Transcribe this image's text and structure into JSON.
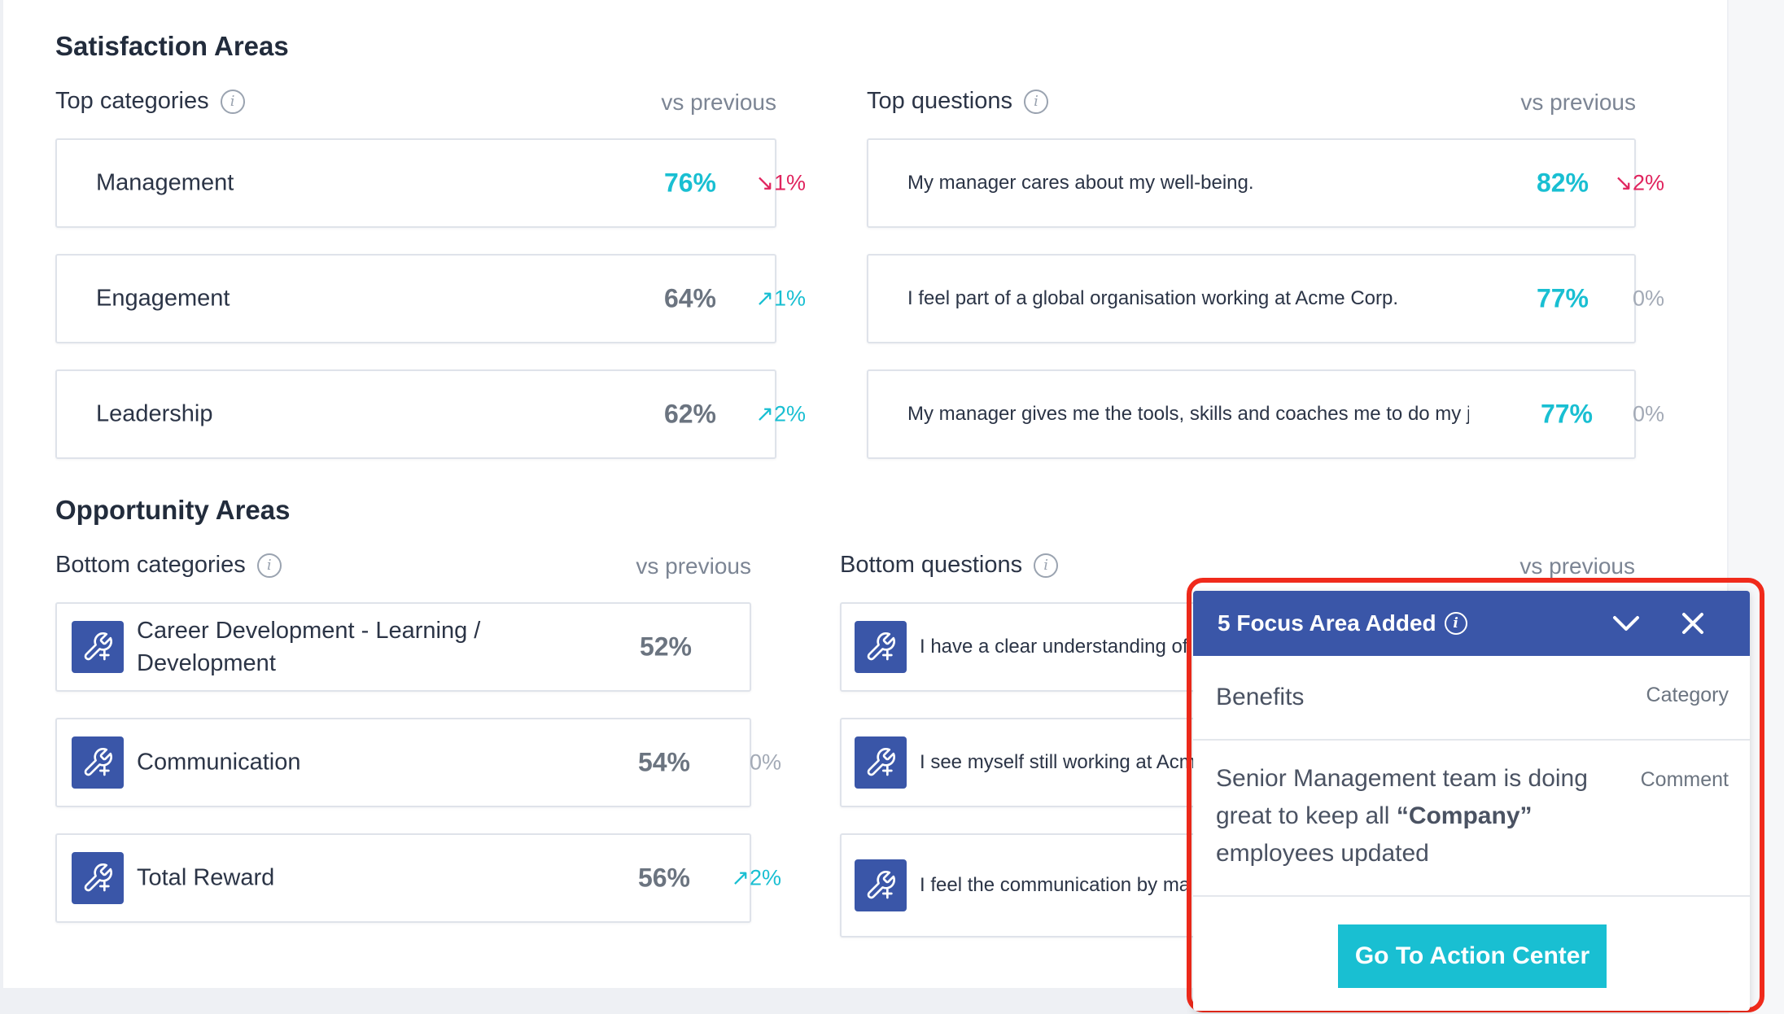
{
  "satisfaction": {
    "title": "Satisfaction Areas",
    "categories": {
      "label": "Top categories",
      "vs_label": "vs previous",
      "items": [
        {
          "name": "Management",
          "pct": "76%",
          "delta": "↘1%"
        },
        {
          "name": "Engagement",
          "pct": "64%",
          "delta": "↗1%"
        },
        {
          "name": "Leadership",
          "pct": "62%",
          "delta": "↗2%"
        }
      ]
    },
    "questions": {
      "label": "Top questions",
      "vs_label": "vs previous",
      "items": [
        {
          "text": "My manager cares about my well-being.",
          "pct": "82%",
          "delta": "↘2%"
        },
        {
          "text": "I feel part of a global organisation working at Acme Corp.",
          "pct": "77%",
          "delta": "0%"
        },
        {
          "text": "My manager gives me the tools, skills and coaches me to do my jo...",
          "pct": "77%",
          "delta": "0%"
        }
      ]
    }
  },
  "opportunity": {
    "title": "Opportunity Areas",
    "categories": {
      "label": "Bottom categories",
      "vs_label": "vs previous",
      "items": [
        {
          "name_line1": "Career Development - Learning /",
          "name_line2": "Development",
          "pct": "52%",
          "delta": ""
        },
        {
          "name": "Communication",
          "pct": "54%",
          "delta": "0%"
        },
        {
          "name": "Total Reward",
          "pct": "56%",
          "delta": "↗2%"
        }
      ]
    },
    "questions": {
      "label": "Bottom questions",
      "vs_label": "vs previous",
      "items": [
        {
          "text": "I have a clear understanding of m"
        },
        {
          "text": "I see myself still working at Acm"
        },
        {
          "text": "I feel the communication by ma"
        }
      ]
    }
  },
  "focus_popup": {
    "title": "5 Focus Area Added",
    "rows": [
      {
        "value": "Benefits",
        "kind": "Category"
      },
      {
        "value_pre": "Senior Management team is doing great to keep all ",
        "value_bold": "“Company”",
        "value_post": " employees updated",
        "kind": "Comment"
      }
    ],
    "action_label": "Go To Action Center"
  },
  "colors": {
    "teal": "#19bfd2",
    "red": "#e0245e",
    "navy": "#3a56a8",
    "highlight": "#f02a1b"
  },
  "icons": [
    "info-icon",
    "wrench-plus-icon",
    "chevron-down-icon",
    "close-icon"
  ]
}
